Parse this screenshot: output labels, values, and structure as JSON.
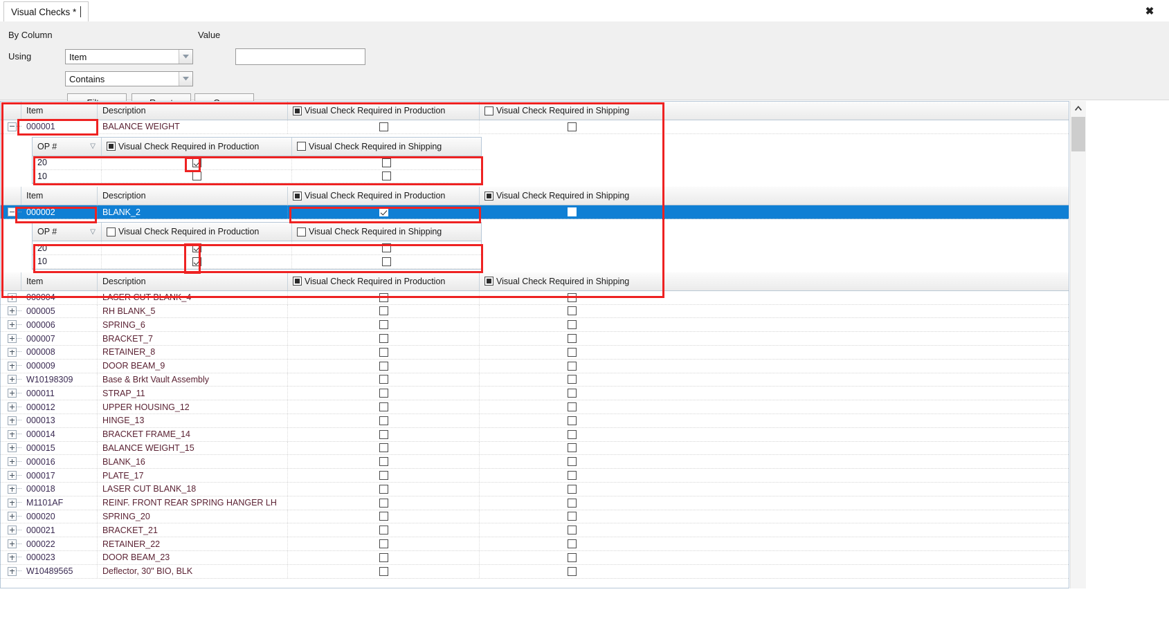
{
  "window": {
    "close_label": "✖"
  },
  "tab": {
    "label": "Visual Checks *"
  },
  "filter_panel": {
    "by_column_label": "By Column",
    "by_column_value": "Item",
    "value_label": "Value",
    "value_input": "",
    "value_placeholder": "",
    "using_label": "Using",
    "using_value": "Contains",
    "filter_button": "Filter",
    "reset_button": "Reset",
    "open_button": "Open"
  },
  "grid": {
    "columns": {
      "item": "Item",
      "description": "Description",
      "production": "Visual Check Required in Production",
      "shipping": "Visual Check Required in Shipping"
    },
    "sub_columns": {
      "op": "OP #",
      "production": "Visual Check Required in Production",
      "shipping": "Visual Check Required in Shipping"
    },
    "sort_glyph": "▽",
    "groups": [
      {
        "item": "000001",
        "description": "BALANCE WEIGHT",
        "production": false,
        "shipping": false,
        "selected": false,
        "expanded": true,
        "header_production": "indeterminate",
        "header_shipping": "unchecked",
        "sub_header_production": "indeterminate",
        "sub_header_shipping": "unchecked",
        "operations": [
          {
            "op": "20",
            "production": true,
            "shipping": false
          },
          {
            "op": "10",
            "production": false,
            "shipping": false
          }
        ]
      },
      {
        "item": "000002",
        "description": "BLANK_2",
        "production": true,
        "shipping": false,
        "selected": true,
        "expanded": true,
        "header_production": "indeterminate",
        "header_shipping": "indeterminate",
        "sub_header_production": "unchecked",
        "sub_header_shipping": "unchecked",
        "operations": [
          {
            "op": "20",
            "production": true,
            "shipping": false
          },
          {
            "op": "10",
            "production": true,
            "shipping": false
          }
        ]
      }
    ],
    "tail_header": {
      "item": "Item",
      "description": "Description",
      "production": "Visual Check Required in Production",
      "shipping": "Visual Check Required in Shipping",
      "production_state": "indeterminate",
      "shipping_state": "indeterminate"
    },
    "rows": [
      {
        "item": "000004",
        "description": "LASER CUT BLANK_4",
        "production": false,
        "shipping": false
      },
      {
        "item": "000005",
        "description": "RH BLANK_5",
        "production": false,
        "shipping": false
      },
      {
        "item": "000006",
        "description": "SPRING_6",
        "production": false,
        "shipping": false
      },
      {
        "item": "000007",
        "description": "BRACKET_7",
        "production": false,
        "shipping": false
      },
      {
        "item": "000008",
        "description": "RETAINER_8",
        "production": false,
        "shipping": false
      },
      {
        "item": "000009",
        "description": "DOOR BEAM_9",
        "production": false,
        "shipping": false
      },
      {
        "item": "W10198309",
        "description": "Base & Brkt Vault Assembly",
        "production": false,
        "shipping": false
      },
      {
        "item": "000011",
        "description": "STRAP_11",
        "production": false,
        "shipping": false
      },
      {
        "item": "000012",
        "description": "UPPER HOUSING_12",
        "production": false,
        "shipping": false
      },
      {
        "item": "000013",
        "description": "HINGE_13",
        "production": false,
        "shipping": false
      },
      {
        "item": "000014",
        "description": "BRACKET FRAME_14",
        "production": false,
        "shipping": false
      },
      {
        "item": "000015",
        "description": "BALANCE WEIGHT_15",
        "production": false,
        "shipping": false
      },
      {
        "item": "000016",
        "description": "BLANK_16",
        "production": false,
        "shipping": false
      },
      {
        "item": "000017",
        "description": "PLATE_17",
        "production": false,
        "shipping": false
      },
      {
        "item": "000018",
        "description": "LASER CUT BLANK_18",
        "production": false,
        "shipping": false
      },
      {
        "item": "M1101AF",
        "description": "REINF. FRONT REAR SPRING HANGER LH",
        "production": false,
        "shipping": false
      },
      {
        "item": "000020",
        "description": "SPRING_20",
        "production": false,
        "shipping": false
      },
      {
        "item": "000021",
        "description": "BRACKET_21",
        "production": false,
        "shipping": false
      },
      {
        "item": "000022",
        "description": "RETAINER_22",
        "production": false,
        "shipping": false
      },
      {
        "item": "000023",
        "description": "DOOR BEAM_23",
        "production": false,
        "shipping": false
      },
      {
        "item": "W10489565",
        "description": "Deflector, 30\" BIO, BLK",
        "production": false,
        "shipping": false
      }
    ]
  },
  "colors": {
    "selection_blue": "#0f7fd4",
    "annotation_red": "#ee2222",
    "panel_gray": "#f0f0f0",
    "item_text": "#3a2a52",
    "description_text": "#5b2233"
  }
}
